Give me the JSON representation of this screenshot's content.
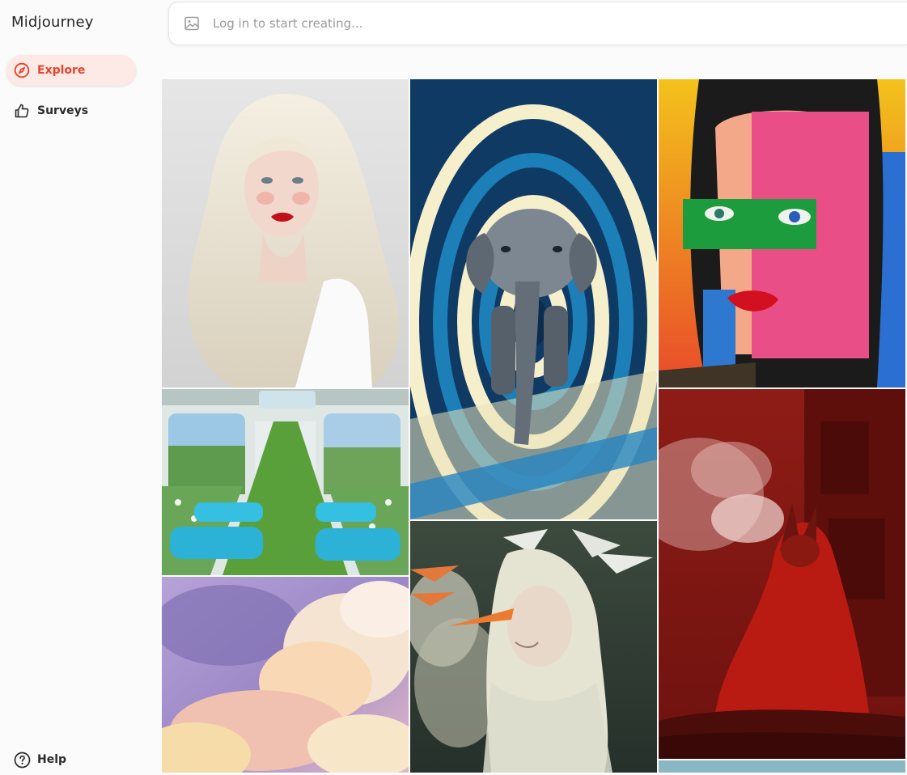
{
  "app": {
    "title": "Midjourney"
  },
  "sidebar": {
    "items": [
      {
        "label": "Explore",
        "icon": "compass-icon",
        "active": true
      },
      {
        "label": "Surveys",
        "icon": "thumbs-up-icon",
        "active": false
      }
    ],
    "help": {
      "label": "Help",
      "icon": "question-circle-icon"
    }
  },
  "search": {
    "placeholder": "Log in to start creating...",
    "icon": "image-icon"
  },
  "colors": {
    "accent": "#e6452c",
    "accent_bg": "#fde9e6"
  },
  "gallery": {
    "items": [
      "platinum-blonde-woman-portrait",
      "train-interior-with-grass-and-flowers",
      "pastel-cloud-painting",
      "elephant-in-hypnotic-spiral",
      "pale-woman-with-stork-birds",
      "pop-art-collage-face",
      "red-dragon-smoking-in-ruins",
      "partially-visible-image"
    ]
  }
}
